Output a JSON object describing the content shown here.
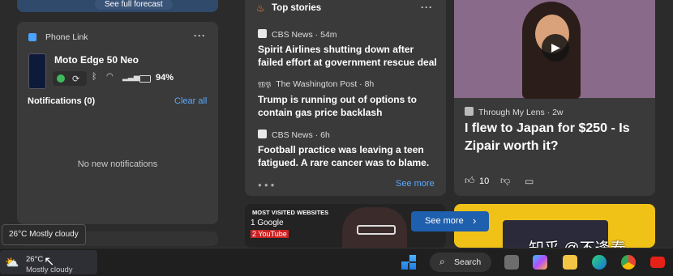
{
  "forecast": {
    "link_label": "See full forecast"
  },
  "phone_link": {
    "title": "Phone Link",
    "menu": "···",
    "device_name": "Moto Edge 50 Neo",
    "battery": "94%",
    "notifications_label": "Notifications (0)",
    "clear_all": "Clear all",
    "empty_text": "No new notifications"
  },
  "top_stories": {
    "title": "Top stories",
    "menu": "···",
    "see_more": "See more",
    "stories": [
      {
        "source": "CBS News",
        "age": "54m",
        "title": "Spirit Airlines shutting down after failed effort at government rescue deal"
      },
      {
        "source": "The Washington Post",
        "age": "8h",
        "title": "Trump is running out of options to contain gas price backlash"
      },
      {
        "source": "CBS News",
        "age": "6h",
        "title": "Football practice was leaving a teen fatigued. A rare cancer was to blame."
      }
    ]
  },
  "video_card": {
    "source": "Through My Lens",
    "age": "2w",
    "title": "I flew to Japan for $250 - Is Zipair worth it?",
    "likes": "10"
  },
  "bottom_cards": {
    "banner_heading": "MOST VISITED WEBSITES",
    "banner_items": [
      "1 Google",
      "2 YouTube"
    ],
    "see_more_button": "See more"
  },
  "tooltip": {
    "text": "26°C Mostly cloudy"
  },
  "watermark": "知乎 @不逢春",
  "taskbar": {
    "weather_temp": "26°C",
    "weather_desc": "Mostly cloudy",
    "search_label": "Search"
  }
}
